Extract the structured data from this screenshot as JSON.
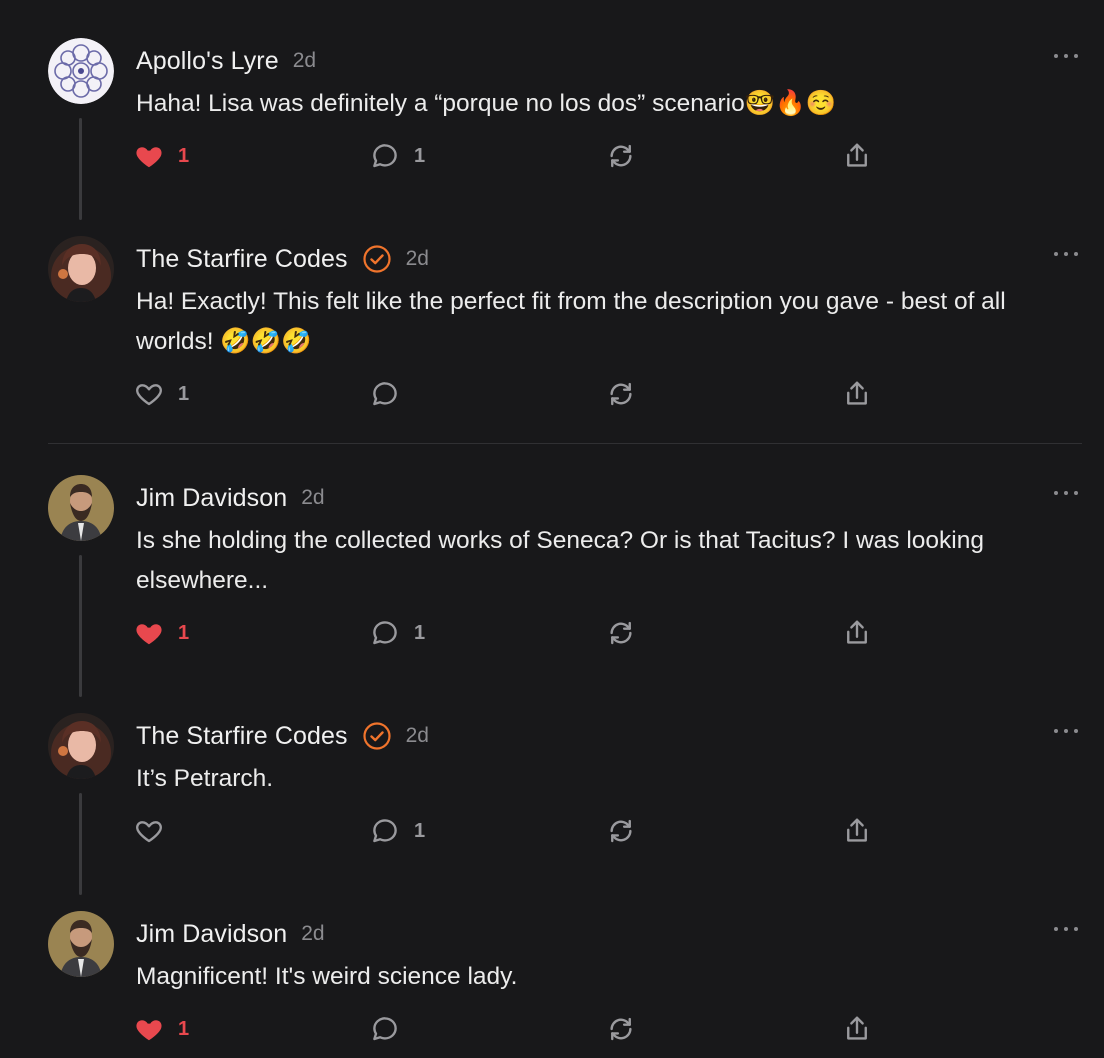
{
  "comments": [
    {
      "author": "Apollo's Lyre",
      "time": "2d",
      "verified": false,
      "avatar": "mandala-avatar",
      "text": "Haha! Lisa was definitely a “porque no los dos” scenario🤓🔥☺️",
      "likes": "1",
      "liked": true,
      "replies": "1"
    },
    {
      "author": "The Starfire Codes",
      "time": "2d",
      "verified": true,
      "avatar": "woman-portrait-avatar",
      "text": "Ha! Exactly! This felt like the perfect fit from the description you gave - best of all worlds! 🤣🤣🤣",
      "likes": "1",
      "liked": false,
      "replies": ""
    },
    {
      "author": "Jim Davidson",
      "time": "2d",
      "verified": false,
      "avatar": "bearded-man-avatar",
      "text": "Is she holding the collected works of Seneca? Or is that Tacitus? I was looking elsewhere...",
      "likes": "1",
      "liked": true,
      "replies": "1"
    },
    {
      "author": "The Starfire Codes",
      "time": "2d",
      "verified": true,
      "avatar": "woman-portrait-avatar",
      "text": "It’s Petrarch.",
      "likes": "",
      "liked": false,
      "replies": "1"
    },
    {
      "author": "Jim Davidson",
      "time": "2d",
      "verified": false,
      "avatar": "bearded-man-avatar",
      "text": "Magnificent! It's weird science lady.",
      "likes": "1",
      "liked": true,
      "replies": ""
    }
  ],
  "colors": {
    "background": "#18181a",
    "liked": "#e8484e",
    "verified": "#f0742c",
    "muted": "#8b8b8f"
  }
}
